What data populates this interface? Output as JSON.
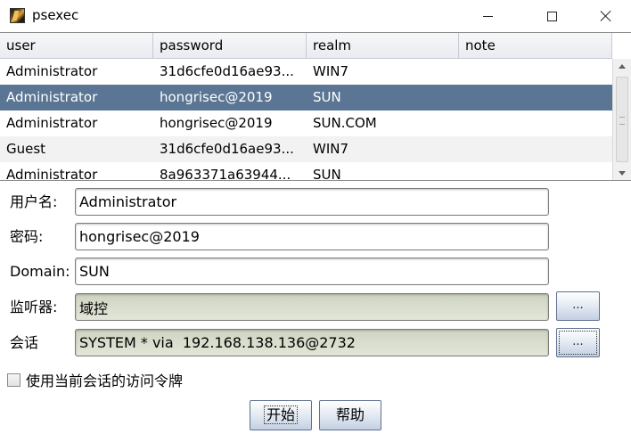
{
  "window": {
    "title": "psexec",
    "icon": "psexec-app-icon",
    "controls": [
      "minimize-icon",
      "maximize-icon",
      "close-icon"
    ]
  },
  "table": {
    "columns": [
      "user",
      "password",
      "realm",
      "note"
    ],
    "rows": [
      {
        "user": "Administrator",
        "password": "31d6cfe0d16ae93...",
        "realm": "WIN7",
        "note": ""
      },
      {
        "user": "Administrator",
        "password": "hongrisec@2019",
        "realm": "SUN",
        "note": ""
      },
      {
        "user": "Administrator",
        "password": "hongrisec@2019",
        "realm": "SUN.COM",
        "note": ""
      },
      {
        "user": "Guest",
        "password": "31d6cfe0d16ae93...",
        "realm": "WIN7",
        "note": ""
      },
      {
        "user": "Administrator",
        "password": "8a963371a63944...",
        "realm": "SUN",
        "note": ""
      }
    ],
    "selected_row": 1
  },
  "form": {
    "username_label": "用户名:",
    "username_value": "Administrator",
    "password_label": "密码:",
    "password_value": "hongrisec@2019",
    "domain_label": "Domain:",
    "domain_value": "SUN",
    "listener_label": "监听器:",
    "listener_value": "域控",
    "listener_button": "...",
    "session_label": "会话",
    "session_value": "SYSTEM * via  192.168.138.136@2732",
    "session_button": "..."
  },
  "checkbox": {
    "label": "使用当前会话的访问令牌",
    "checked": false
  },
  "buttons": {
    "launch": "开始",
    "help": "帮助"
  },
  "colors": {
    "selected_row": "#5b7694",
    "readonly_field": "#dde1d1"
  }
}
